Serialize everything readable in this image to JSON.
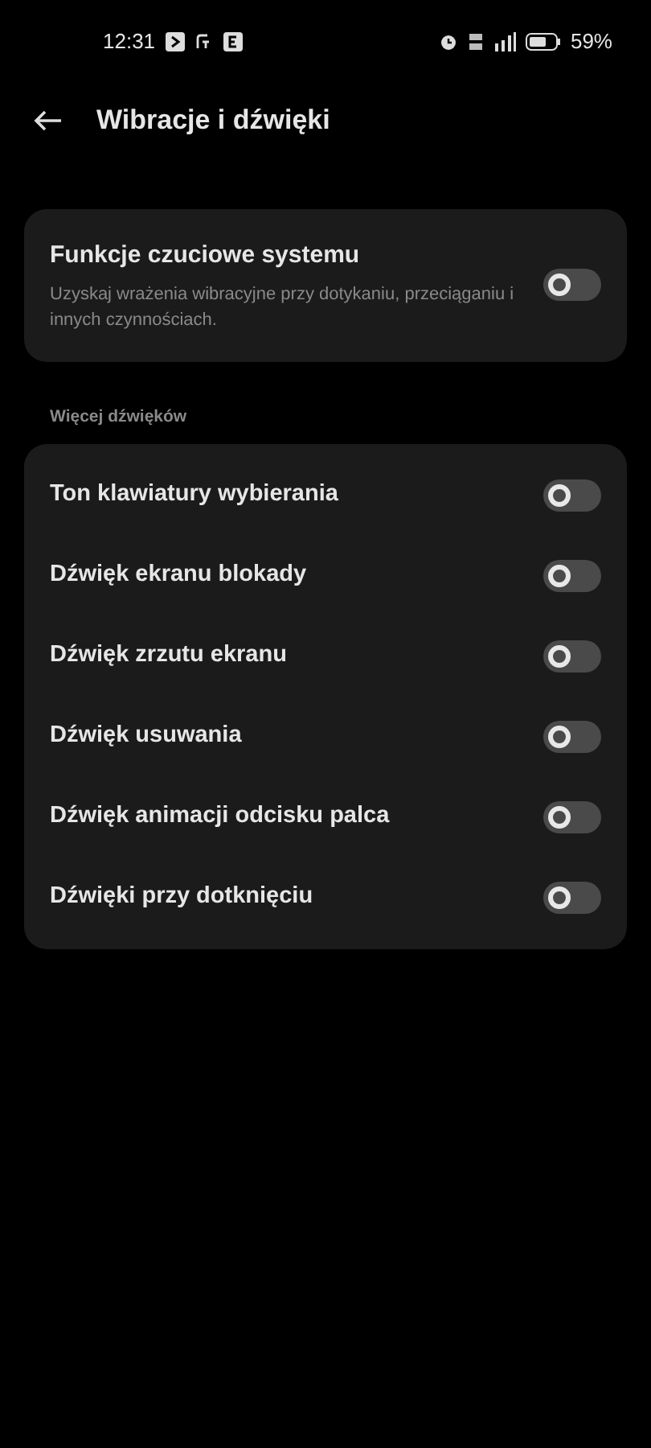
{
  "status_bar": {
    "time": "12:31",
    "battery": "59%"
  },
  "header": {
    "title": "Wibracje i dźwięki"
  },
  "haptics": {
    "title": "Funkcje czuciowe systemu",
    "description": "Uzyskaj wrażenia wibracyjne przy dotykaniu, przeciąganiu i innych czynnościach.",
    "on": false
  },
  "section": {
    "title": "Więcej dźwięków"
  },
  "items": [
    {
      "label": "Ton klawiatury wybierania",
      "on": false
    },
    {
      "label": "Dźwięk ekranu blokady",
      "on": false
    },
    {
      "label": "Dźwięk zrzutu ekranu",
      "on": false
    },
    {
      "label": "Dźwięk usuwania",
      "on": false
    },
    {
      "label": "Dźwięk animacji odcisku palca",
      "on": false
    },
    {
      "label": "Dźwięki przy dotknięciu",
      "on": false
    }
  ]
}
